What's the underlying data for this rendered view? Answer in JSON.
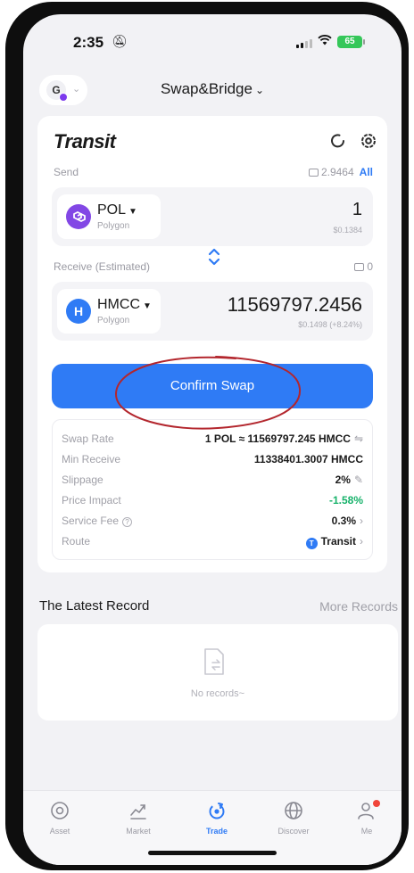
{
  "status_bar": {
    "time": "2:35",
    "battery": "65"
  },
  "header": {
    "avatar_letter": "G",
    "title": "Swap&Bridge",
    "title_caret": "⌄"
  },
  "swap": {
    "brand": "Transit",
    "send": {
      "label": "Send",
      "balance": "2.9464",
      "all_label": "All",
      "token": "POL",
      "network": "Polygon",
      "amount": "1",
      "usd": "$0.1384"
    },
    "receive": {
      "label": "Receive (Estimated)",
      "balance": "0",
      "token": "HMCC",
      "token_logo_letter": "H",
      "network": "Polygon",
      "amount": "11569797.2456",
      "usd": "$0.1498 (+8.24%)"
    },
    "confirm_label": "Confirm Swap",
    "details": {
      "swap_rate": {
        "label": "Swap Rate",
        "value": "1 POL ≈ 11569797.245 HMCC",
        "suffix": "⇋"
      },
      "min_receive": {
        "label": "Min Receive",
        "value": "11338401.3007 HMCC"
      },
      "slippage": {
        "label": "Slippage",
        "value": "2%",
        "suffix": "✎"
      },
      "price_impact": {
        "label": "Price Impact",
        "value": "-1.58%"
      },
      "service_fee": {
        "label": "Service Fee",
        "value": "0.3%",
        "suffix": "›"
      },
      "route": {
        "label": "Route",
        "value": "Transit",
        "suffix": "›"
      }
    }
  },
  "latest_record": {
    "title": "The Latest Record",
    "more_label": "More Records",
    "empty_text": "No records~"
  },
  "tabbar": {
    "tabs": [
      {
        "label": "Asset",
        "icon": "asset-icon"
      },
      {
        "label": "Market",
        "icon": "market-icon"
      },
      {
        "label": "Trade",
        "icon": "trade-icon",
        "active": true
      },
      {
        "label": "Discover",
        "icon": "discover-icon"
      },
      {
        "label": "Me",
        "icon": "me-icon"
      }
    ]
  },
  "colors": {
    "accent": "#2f7bf5",
    "positive": "#17b26a",
    "polygon": "#8247e5",
    "annotation": "#b3262d"
  }
}
